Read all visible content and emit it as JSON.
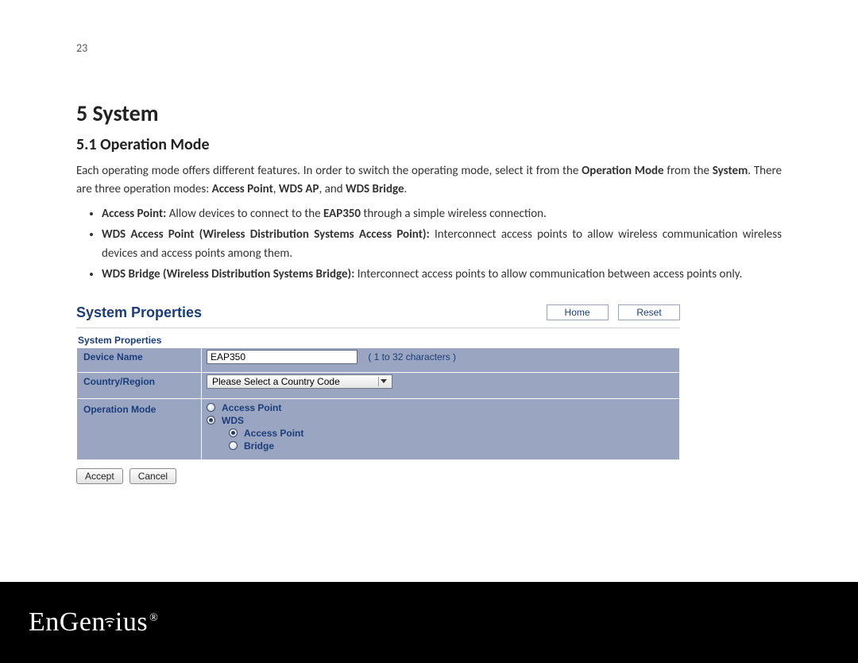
{
  "page_number": "23",
  "headings": {
    "h1": "5  System",
    "h2": "5.1  Operation Mode"
  },
  "intro_html": "Each operating mode offers different features. In order to switch the operating mode, select it from the <b>Operation Mode</b> from the <b>System</b>. There are three operation modes: <b>Access Point</b>, <b>WDS AP</b>, and <b>WDS Bridge</b>.",
  "bullets": [
    "<b>Access Point:</b>  Allow devices to connect to the <b>EAP350</b> through a simple wireless connection.",
    "<b>WDS Access Point (Wireless Distribution Systems Access Point):</b> Interconnect access points to allow wireless communication wireless devices and access points among them.",
    "<b>WDS Bridge (Wireless Distribution Systems Bridge):</b> Interconnect access points to allow communication between access points only."
  ],
  "ui": {
    "panel_title": "System Properties",
    "links": {
      "home": "Home",
      "reset": "Reset"
    },
    "subhead": "System Properties",
    "rows": {
      "device_name": {
        "label": "Device Name",
        "value": "EAP350",
        "hint": "( 1 to 32 characters )"
      },
      "country": {
        "label": "Country/Region",
        "value": "Please Select a Country Code"
      },
      "op_mode": {
        "label": "Operation Mode",
        "options": {
          "ap": "Access Point",
          "wds": "WDS",
          "wds_ap": "Access Point",
          "wds_bridge": "Bridge"
        },
        "selected_top": "wds",
        "selected_sub": "wds_ap"
      }
    },
    "buttons": {
      "accept": "Accept",
      "cancel": "Cancel"
    }
  },
  "footer": {
    "brand": "EnGenius",
    "reg": "®"
  }
}
